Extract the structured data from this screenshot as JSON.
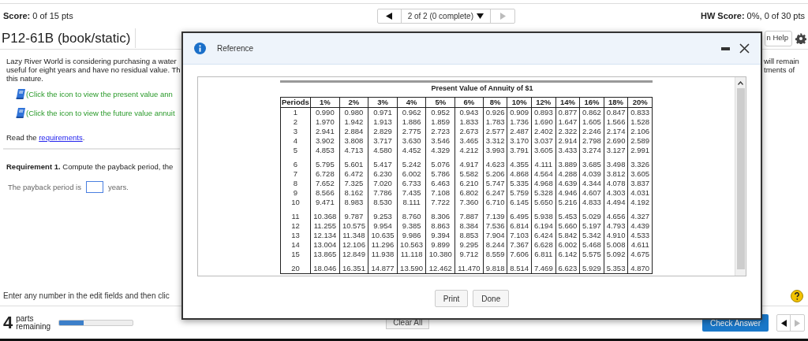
{
  "top_bar": {
    "score_label": "Score:",
    "score": "0 of 15 pts",
    "pager_text": "2 of 2 (0 complete)",
    "hw_label": "HW Score:",
    "hw_score": "0%, 0 of 30 pts"
  },
  "title": "P12-61B (book/static)",
  "help_button": "n Help",
  "problem": {
    "lines_left": [
      "Lazy River World is considering purchasing a water",
      "useful for eight years and have no residual value. Th",
      "this nature."
    ],
    "lines_right": [
      "will remain",
      "tments of"
    ],
    "icon_links": [
      "(Click the icon to view the present value ann",
      "(Click the icon to view the future value annuit"
    ],
    "read_prefix": "Read the ",
    "read_link": "requirements",
    "read_suffix": "."
  },
  "requirement": "**Requirement 1.** Compute the payback period, the",
  "answer": {
    "prefix": "The payback period is",
    "suffix": "years."
  },
  "footer_hint": "Enter any number in the edit fields and then clic",
  "parts": {
    "count": "4",
    "label": [
      "parts",
      "remaining"
    ],
    "level": 0.33
  },
  "clear_button": "Clear All",
  "check_button": "Check Answer",
  "modal": {
    "title": "Reference",
    "table_title": "Present Value of Annuity of $1",
    "columns": [
      "Periods",
      "1%",
      "2%",
      "3%",
      "4%",
      "5%",
      "6%",
      "8%",
      "10%",
      "12%",
      "14%",
      "16%",
      "18%",
      "20%"
    ],
    "row_groups": [
      [
        [
          "1",
          "0.990",
          "0.980",
          "0.971",
          "0.962",
          "0.952",
          "0.943",
          "0.926",
          "0.909",
          "0.893",
          "0.877",
          "0.862",
          "0.847",
          "0.833"
        ],
        [
          "2",
          "1.970",
          "1.942",
          "1.913",
          "1.886",
          "1.859",
          "1.833",
          "1.783",
          "1.736",
          "1.690",
          "1.647",
          "1.605",
          "1.566",
          "1.528"
        ],
        [
          "3",
          "2.941",
          "2.884",
          "2.829",
          "2.775",
          "2.723",
          "2.673",
          "2.577",
          "2.487",
          "2.402",
          "2.322",
          "2.246",
          "2.174",
          "2.106"
        ],
        [
          "4",
          "3.902",
          "3.808",
          "3.717",
          "3.630",
          "3.546",
          "3.465",
          "3.312",
          "3.170",
          "3.037",
          "2.914",
          "2.798",
          "2.690",
          "2.589"
        ],
        [
          "5",
          "4.853",
          "4.713",
          "4.580",
          "4.452",
          "4.329",
          "4.212",
          "3.993",
          "3.791",
          "3.605",
          "3.433",
          "3.274",
          "3.127",
          "2.991"
        ]
      ],
      [
        [
          "6",
          "5.795",
          "5.601",
          "5.417",
          "5.242",
          "5.076",
          "4.917",
          "4.623",
          "4.355",
          "4.111",
          "3.889",
          "3.685",
          "3.498",
          "3.326"
        ],
        [
          "7",
          "6.728",
          "6.472",
          "6.230",
          "6.002",
          "5.786",
          "5.582",
          "5.206",
          "4.868",
          "4.564",
          "4.288",
          "4.039",
          "3.812",
          "3.605"
        ],
        [
          "8",
          "7.652",
          "7.325",
          "7.020",
          "6.733",
          "6.463",
          "6.210",
          "5.747",
          "5.335",
          "4.968",
          "4.639",
          "4.344",
          "4.078",
          "3.837"
        ],
        [
          "9",
          "8.566",
          "8.162",
          "7.786",
          "7.435",
          "7.108",
          "6.802",
          "6.247",
          "5.759",
          "5.328",
          "4.946",
          "4.607",
          "4.303",
          "4.031"
        ],
        [
          "10",
          "9.471",
          "8.983",
          "8.530",
          "8.111",
          "7.722",
          "7.360",
          "6.710",
          "6.145",
          "5.650",
          "5.216",
          "4.833",
          "4.494",
          "4.192"
        ]
      ],
      [
        [
          "11",
          "10.368",
          "9.787",
          "9.253",
          "8.760",
          "8.306",
          "7.887",
          "7.139",
          "6.495",
          "5.938",
          "5.453",
          "5.029",
          "4.656",
          "4.327"
        ],
        [
          "12",
          "11.255",
          "10.575",
          "9.954",
          "9.385",
          "8.863",
          "8.384",
          "7.536",
          "6.814",
          "6.194",
          "5.660",
          "5.197",
          "4.793",
          "4.439"
        ],
        [
          "13",
          "12.134",
          "11.348",
          "10.635",
          "9.986",
          "9.394",
          "8.853",
          "7.904",
          "7.103",
          "6.424",
          "5.842",
          "5.342",
          "4.910",
          "4.533"
        ],
        [
          "14",
          "13.004",
          "12.106",
          "11.296",
          "10.563",
          "9.899",
          "9.295",
          "8.244",
          "7.367",
          "6.628",
          "6.002",
          "5.468",
          "5.008",
          "4.611"
        ],
        [
          "15",
          "13.865",
          "12.849",
          "11.938",
          "11.118",
          "10.380",
          "9.712",
          "8.559",
          "7.606",
          "6.811",
          "6.142",
          "5.575",
          "5.092",
          "4.675"
        ]
      ],
      [
        [
          "20",
          "18.046",
          "16.351",
          "14.877",
          "13.590",
          "12.462",
          "11.470",
          "9.818",
          "8.514",
          "7.469",
          "6.623",
          "5.929",
          "5.353",
          "4.870"
        ]
      ]
    ],
    "buttons": [
      "Print",
      "Done"
    ]
  }
}
